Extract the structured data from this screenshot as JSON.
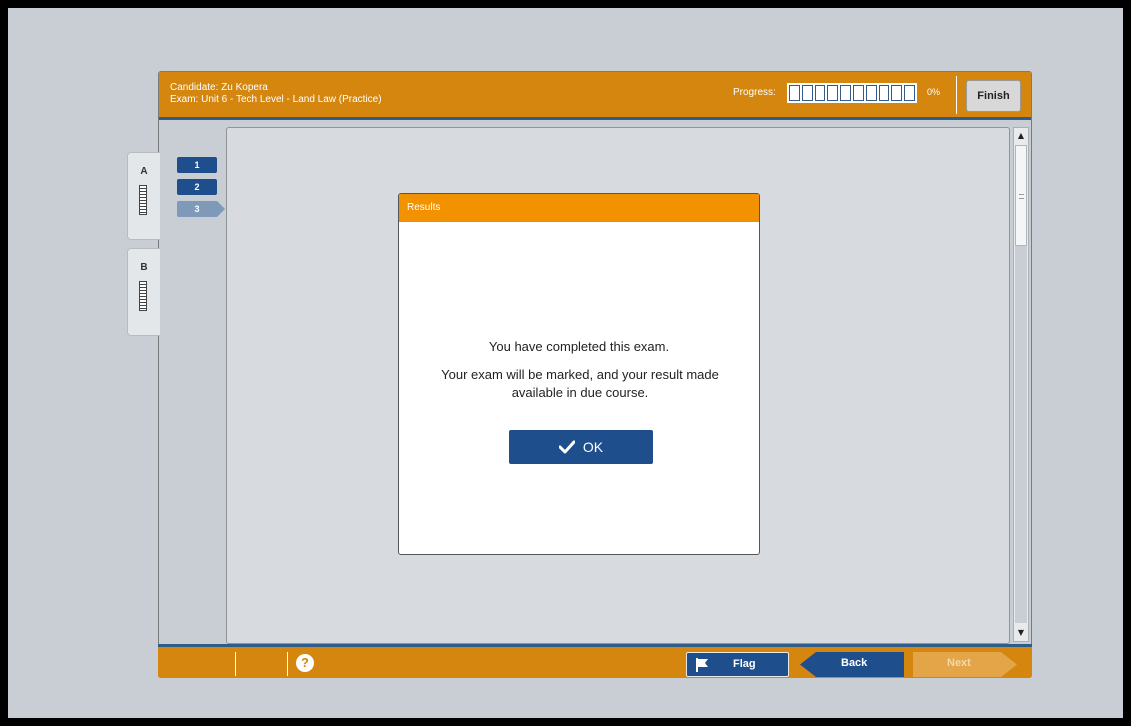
{
  "header": {
    "candidate": "Candidate: Zu Kopera",
    "exam": "Exam: Unit 6 - Tech Level - Land Law (Practice)",
    "progress_label": "Progress:",
    "progress_percent": "0%",
    "progress_fraction": 0,
    "progress_segments": 10,
    "finish_label": "Finish"
  },
  "sections": [
    {
      "label": "A"
    },
    {
      "label": "B"
    }
  ],
  "questions": [
    {
      "label": "1",
      "state": "answered"
    },
    {
      "label": "2",
      "state": "answered"
    },
    {
      "label": "3",
      "state": "current"
    }
  ],
  "dialog": {
    "title": "Results",
    "message1": "You have completed this exam.",
    "message2": "Your exam will be marked, and your result made available in due course.",
    "ok_label": "OK"
  },
  "footer": {
    "help_icon": "question-circle-icon",
    "flag_label": "Flag",
    "back_label": "Back",
    "next_label": "Next"
  },
  "colors": {
    "accent_orange": "#d4860f",
    "dialog_header": "#f39200",
    "primary_blue": "#1f4e8c"
  }
}
